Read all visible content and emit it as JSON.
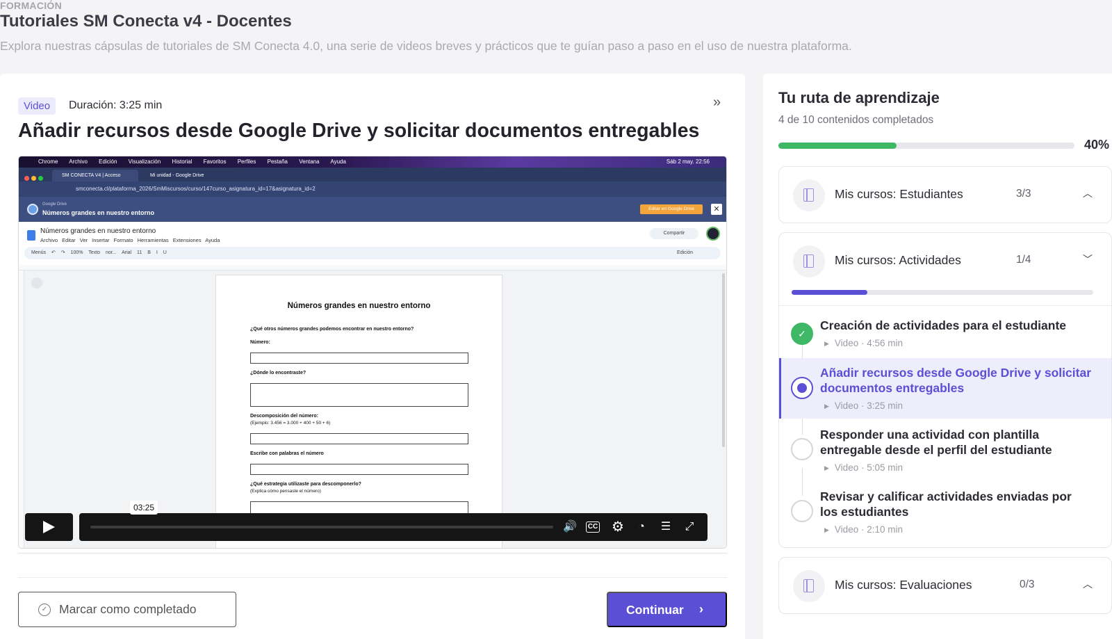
{
  "page": {
    "eyebrow": "FORMACIÓN",
    "title": "Tutoriales SM Conecta v4 - Docentes",
    "subtitle": "Explora nuestras cápsulas de tutoriales de SM Conecta 4.0, una serie de videos breves y prácticos que te guían paso a paso en el uso de nuestra plataforma."
  },
  "lesson": {
    "tag": "Video",
    "duration": "Duración: 3:25 min",
    "expand_icon": "»",
    "title": "Añadir recursos desde Google Drive y solicitar documentos entregables"
  },
  "video": {
    "mac_menu": [
      "Chrome",
      "Archivo",
      "Edición",
      "Visualización",
      "Historial",
      "Favoritos",
      "Perfiles",
      "Pestaña",
      "Ventana",
      "Ayuda"
    ],
    "mac_clock": "Sáb 2 may. 22:56",
    "tab1": "SM CONECTA V4 | Acceso",
    "tab2": "Mi unidad - Google Drive",
    "url": "smconecta.cl/plataforma_2026/SmMiscursos/curso/147curso_asignatura_id=17&asignatura_id=2",
    "gdrive_label": "Google Drive",
    "gdrive_doc": "Números grandes en nuestro entorno",
    "gdrive_edit_btn": "Editar en Google Drive",
    "doc_name": "Números grandes en nuestro entorno",
    "doc_menu": "Archivo Editar Ver Insertar Formato Herramientas Extensiones Ayuda",
    "doc_share": "Compartir",
    "toolbar": "Menús ↶ ↷ 100% Texto nor... Arial 11 B I U",
    "toolbar_mode": "Edición",
    "doc_heading": "Números grandes en nuestro entorno",
    "q1": "¿Qué otros números grandes podemos encontrar en nuestro entorno?",
    "q1_label": "Número:",
    "q2": "¿Dónde lo encontraste?",
    "q3": "Descomposición del número:",
    "q3_example": "(Ejemplo: 3.456 = 3.000 + 400 + 50 + 6)",
    "q4": "Escribe con palabras el número",
    "q5": "¿Qué estrategia utilizaste para descomponerlo?",
    "q5_note": "(Explica cómo pensaste el número)",
    "current_time": "03:25",
    "progress": 0.0
  },
  "actions": {
    "mark_complete": "Marcar como completado",
    "continue": "Continuar"
  },
  "sidebar": {
    "title": "Tu ruta de aprendizaje",
    "summary": "4 de 10 contenidos completados",
    "percent_label": "40%",
    "percent": 40,
    "modules": [
      {
        "name": "Mis cursos: Estudiantes",
        "count": "3/3",
        "expanded": false
      },
      {
        "name": "Mis cursos: Actividades",
        "count": "1/4",
        "expanded": true,
        "progress": 25,
        "lessons": [
          {
            "title": "Creación de actividades para el estudiante",
            "meta": "Video · 4:56 min",
            "state": "done"
          },
          {
            "title": "Añadir recursos desde Google Drive y solicitar documentos entregables",
            "meta": "Video · 3:25 min",
            "state": "active"
          },
          {
            "title": "Responder una actividad con plantilla entregable desde el perfil del estudiante",
            "meta": "Video · 5:05 min",
            "state": "pending"
          },
          {
            "title": "Revisar y calificar actividades enviadas por los estudiantes",
            "meta": "Video · 2:10 min",
            "state": "pending"
          }
        ]
      },
      {
        "name": "Mis cursos: Evaluaciones",
        "count": "0/3",
        "expanded": false
      }
    ]
  },
  "colors": {
    "accent": "#5b4fd6",
    "success": "#3fb866"
  }
}
